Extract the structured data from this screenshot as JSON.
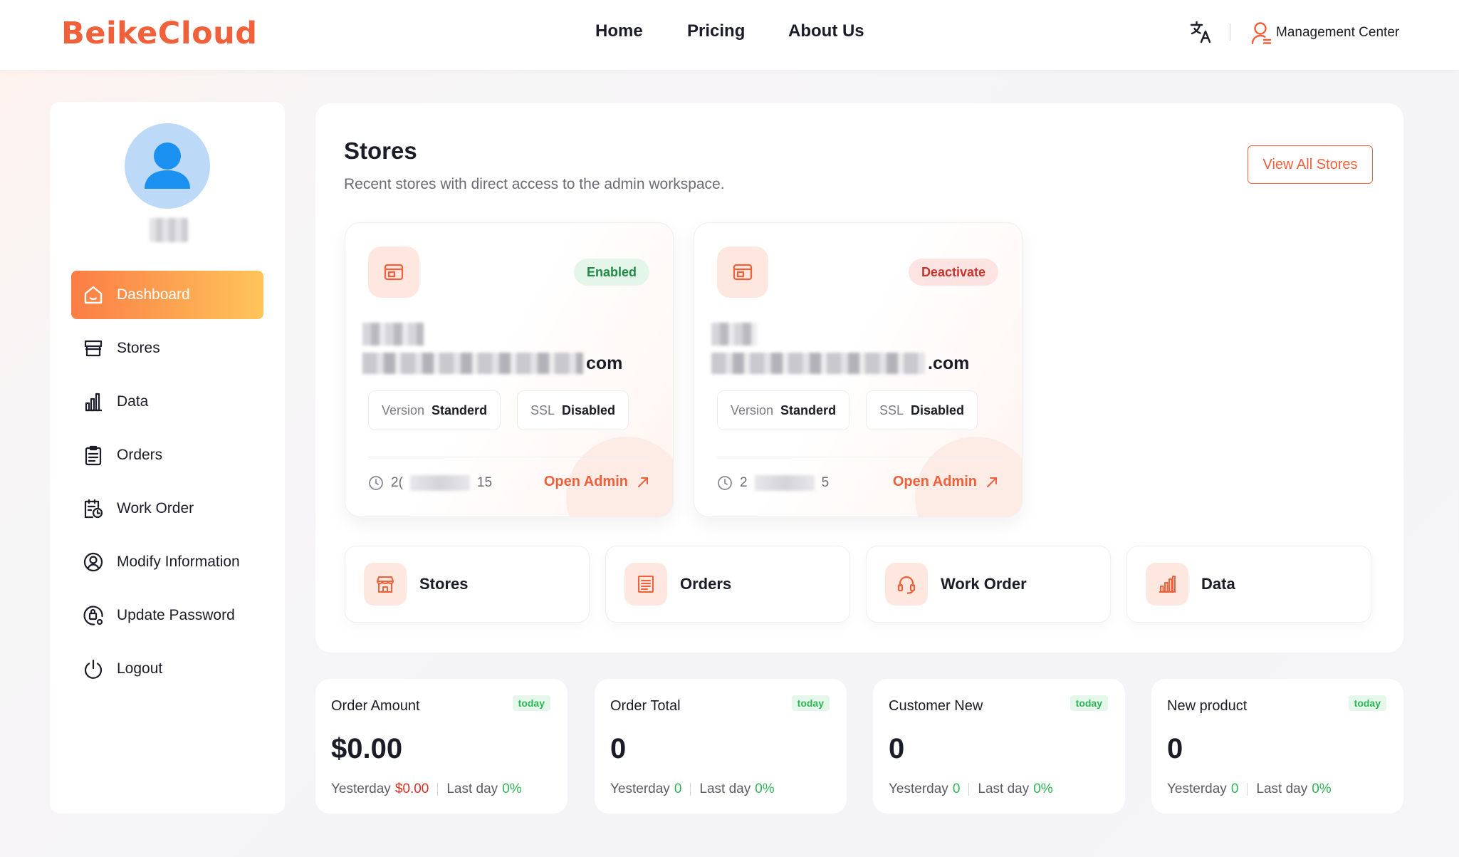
{
  "brand": "BeikeCloud",
  "colors": {
    "accent": "#f0603a",
    "gradient_start": "#fb7d45",
    "gradient_end": "#fec55a",
    "success": "#2fb455",
    "danger": "#d93025"
  },
  "nav": {
    "home": "Home",
    "pricing": "Pricing",
    "about": "About Us"
  },
  "header": {
    "management": "Management Center",
    "translate_icon": "translate-icon",
    "user_icon": "user-icon"
  },
  "sidebar": {
    "items": [
      {
        "label": "Dashboard",
        "icon": "home-icon"
      },
      {
        "label": "Stores",
        "icon": "store-icon"
      },
      {
        "label": "Data",
        "icon": "bar-chart-icon"
      },
      {
        "label": "Orders",
        "icon": "clipboard-icon"
      },
      {
        "label": "Work Order",
        "icon": "schedule-icon"
      },
      {
        "label": "Modify Information",
        "icon": "account-icon"
      },
      {
        "label": "Update Password",
        "icon": "lock-settings-icon"
      },
      {
        "label": "Logout",
        "icon": "power-icon"
      }
    ]
  },
  "stores": {
    "title": "Stores",
    "subtitle": "Recent stores with direct access to the admin workspace.",
    "view_all": "View All Stores",
    "cards": [
      {
        "status": "Enabled",
        "domain_suffix": "com",
        "version_label": "Version",
        "version": "Standerd",
        "ssl_label": "SSL",
        "ssl": "Disabled",
        "date_prefix": "2(",
        "date_suffix": "15",
        "open": "Open Admin"
      },
      {
        "status": "Deactivate",
        "domain_suffix": ".com",
        "version_label": "Version",
        "version": "Standerd",
        "ssl_label": "SSL",
        "ssl": "Disabled",
        "date_prefix": "2",
        "date_suffix": "5",
        "open": "Open Admin"
      }
    ]
  },
  "quick_links": [
    {
      "label": "Stores",
      "icon": "shop-icon"
    },
    {
      "label": "Orders",
      "icon": "receipt-icon"
    },
    {
      "label": "Work Order",
      "icon": "headset-icon"
    },
    {
      "label": "Data",
      "icon": "bar-chart-icon"
    }
  ],
  "stats": [
    {
      "title": "Order Amount",
      "badge": "today",
      "value": "$0.00",
      "yesterday_label": "Yesterday",
      "yesterday": "$0.00",
      "lastday_label": "Last day",
      "lastday": "0%"
    },
    {
      "title": "Order Total",
      "badge": "today",
      "value": "0",
      "yesterday_label": "Yesterday",
      "yesterday": "0",
      "lastday_label": "Last day",
      "lastday": "0%"
    },
    {
      "title": "Customer New",
      "badge": "today",
      "value": "0",
      "yesterday_label": "Yesterday",
      "yesterday": "0",
      "lastday_label": "Last day",
      "lastday": "0%"
    },
    {
      "title": "New product",
      "badge": "today",
      "value": "0",
      "yesterday_label": "Yesterday",
      "yesterday": "0",
      "lastday_label": "Last day",
      "lastday": "0%"
    }
  ]
}
